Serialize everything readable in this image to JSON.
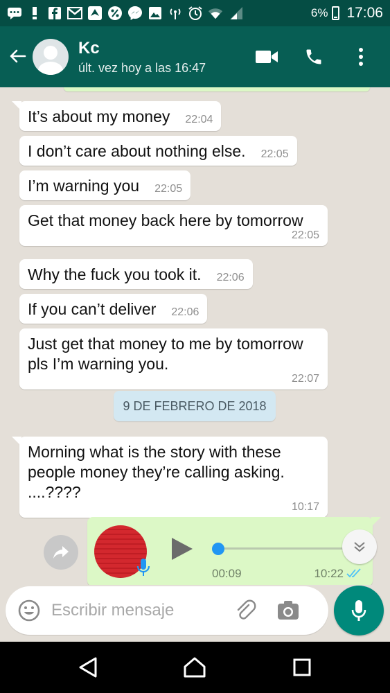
{
  "status_bar": {
    "battery": "6%",
    "time": "17:06",
    "icons": [
      "message-icon",
      "alert-icon",
      "facebook-icon",
      "gmail-icon",
      "app-icon",
      "percent-icon",
      "messenger-icon",
      "image-icon",
      "hotspot-icon",
      "alarm-icon",
      "wifi-icon",
      "signal-icon",
      "battery-icon"
    ]
  },
  "header": {
    "contact_name": "Kc",
    "last_seen": "últ. vez hoy a las 16:47"
  },
  "messages": [
    {
      "text": "It’s about my money",
      "time": "22:04"
    },
    {
      "text": "I don’t care about nothing else.",
      "time": "22:05"
    },
    {
      "text": "I’m warning you",
      "time": "22:05"
    },
    {
      "text": "Get that money back here by tomorrow",
      "time": "22:05"
    },
    {
      "text": "Why the fuck you took it.",
      "time": "22:06"
    },
    {
      "text": "If you can’t deliver",
      "time": "22:06"
    },
    {
      "text": "Just get that money to me by tomorrow pls I’m warning you.",
      "time": "22:07"
    },
    {
      "text": "Morning what is the story with these people money they’re calling asking. ....????",
      "time": "10:17"
    }
  ],
  "date_divider": "9 DE FEBRERO DE 2018",
  "voice_message": {
    "duration": "00:09",
    "time": "10:22",
    "progress": 0
  },
  "composer": {
    "placeholder": "Escribir mensaje"
  },
  "colors": {
    "header": "#075e54",
    "status_bar": "#054d44",
    "outgoing_bubble": "#dcf8c6",
    "chat_background": "#e4dfd8",
    "mic_button": "#00897b",
    "read_ticks": "#4fc3f7"
  }
}
